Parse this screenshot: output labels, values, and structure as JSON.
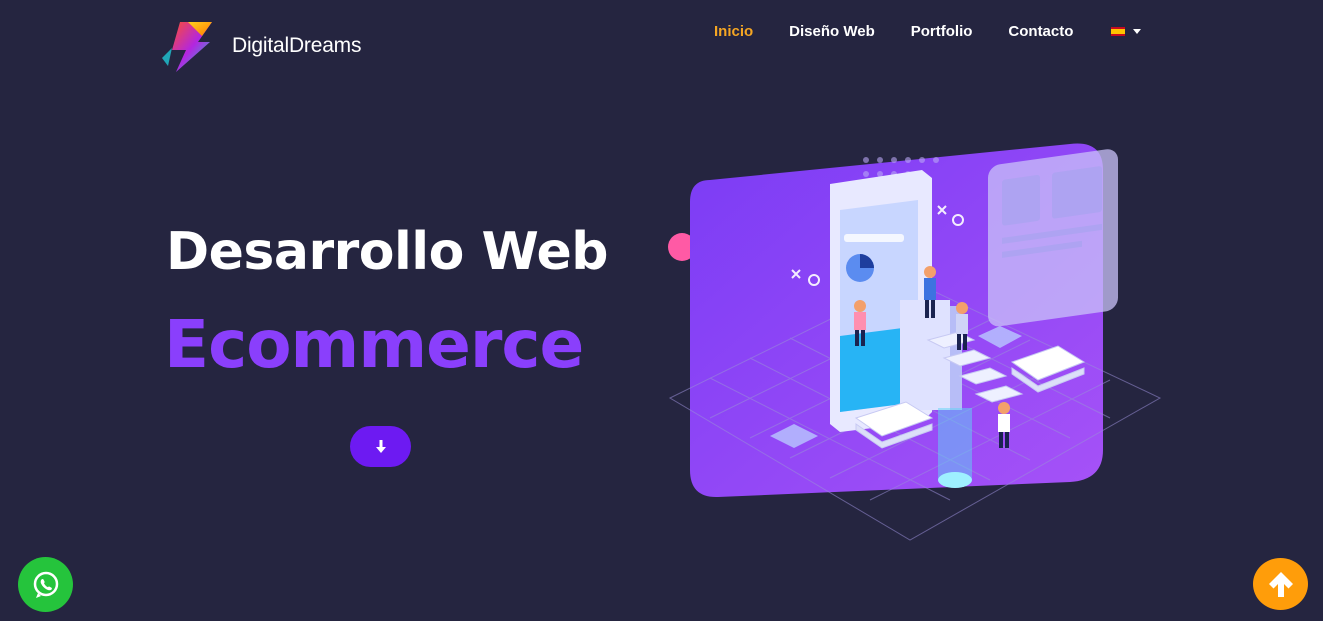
{
  "brand": {
    "name": "DigitalDreams",
    "logo_icon": "lightning-logo-icon"
  },
  "nav": {
    "items": [
      {
        "label": "Inicio",
        "active": true
      },
      {
        "label": "Diseño Web",
        "active": false
      },
      {
        "label": "Portfolio",
        "active": false
      },
      {
        "label": "Contacto",
        "active": false
      }
    ],
    "language_icon": "spain-flag-icon"
  },
  "hero": {
    "title": "Desarrollo Web",
    "subtitle": "Ecommerce",
    "scroll_icon": "arrow-down-icon"
  },
  "floating": {
    "whatsapp_icon": "whatsapp-icon",
    "back_to_top_icon": "arrow-up-icon"
  },
  "colors": {
    "background": "#252540",
    "accent_purple": "#8a3ffc",
    "button_purple": "#6d1af2",
    "active_nav": "#f5a623",
    "whatsapp_green": "#25c43c",
    "top_button_orange": "#ff9d0a"
  }
}
